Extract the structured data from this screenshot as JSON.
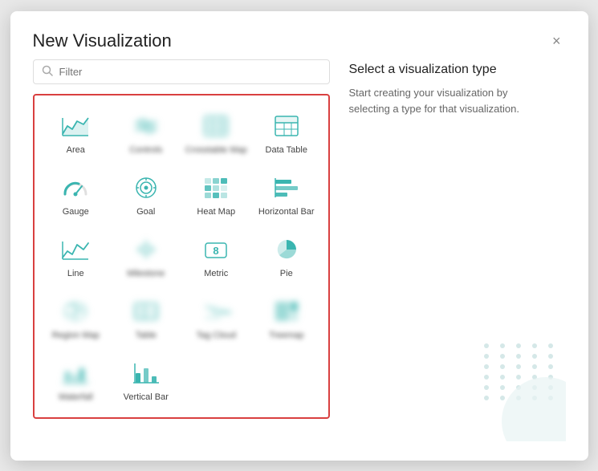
{
  "dialog": {
    "title": "New Visualization",
    "close_label": "×"
  },
  "filter": {
    "placeholder": "Filter"
  },
  "right_panel": {
    "title": "Select a visualization type",
    "description": "Start creating your visualization by selecting a type for that visualization."
  },
  "viz_items": [
    {
      "id": "area",
      "label": "Area",
      "blurred": false,
      "icon": "area"
    },
    {
      "id": "controls",
      "label": "Controls",
      "blurred": true,
      "icon": "controls"
    },
    {
      "id": "crosstab",
      "label": "Crosstable Map",
      "blurred": true,
      "icon": "crosstab"
    },
    {
      "id": "data-table",
      "label": "Data Table",
      "blurred": false,
      "icon": "data-table"
    },
    {
      "id": "gauge",
      "label": "Gauge",
      "blurred": false,
      "icon": "gauge"
    },
    {
      "id": "goal",
      "label": "Goal",
      "blurred": false,
      "icon": "goal"
    },
    {
      "id": "heat-map",
      "label": "Heat Map",
      "blurred": false,
      "icon": "heat-map"
    },
    {
      "id": "horizontal-bar",
      "label": "Horizontal Bar",
      "blurred": false,
      "icon": "horizontal-bar"
    },
    {
      "id": "line",
      "label": "Line",
      "blurred": false,
      "icon": "line"
    },
    {
      "id": "milestone",
      "label": "Milestone",
      "blurred": true,
      "icon": "milestone"
    },
    {
      "id": "metric",
      "label": "Metric",
      "blurred": false,
      "icon": "metric"
    },
    {
      "id": "pie",
      "label": "Pie",
      "blurred": false,
      "icon": "pie"
    },
    {
      "id": "region-map",
      "label": "Region Map",
      "blurred": true,
      "icon": "region-map"
    },
    {
      "id": "table",
      "label": "Table",
      "blurred": true,
      "icon": "table"
    },
    {
      "id": "tag-cloud",
      "label": "Tag Cloud",
      "blurred": true,
      "icon": "tag-cloud"
    },
    {
      "id": "treemap",
      "label": "Treemap",
      "blurred": true,
      "icon": "treemap"
    },
    {
      "id": "waterfall",
      "label": "Waterfall",
      "blurred": true,
      "icon": "waterfall"
    },
    {
      "id": "vertical-bar",
      "label": "Vertical Bar",
      "blurred": false,
      "icon": "vertical-bar"
    }
  ]
}
